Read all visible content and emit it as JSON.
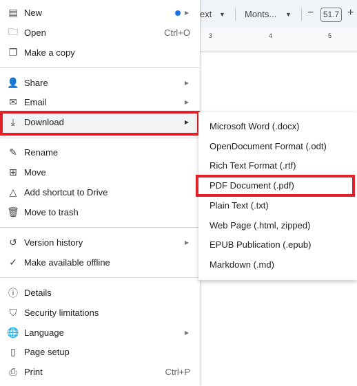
{
  "toolbar": {
    "style_partial": "ext",
    "font": "Monts...",
    "font_size": "51.7",
    "minus": "−",
    "plus": "+"
  },
  "ruler": {
    "marks": [
      "3",
      "4",
      "5"
    ]
  },
  "menu": {
    "items": [
      {
        "label": "New",
        "icon": "document-icon",
        "submenu": true,
        "badge": true
      },
      {
        "label": "Open",
        "icon": "folder-icon",
        "shortcut": "Ctrl+O"
      },
      {
        "label": "Make a copy",
        "icon": "copy-icon"
      },
      {
        "label": "Share",
        "icon": "person-add-icon",
        "submenu": true
      },
      {
        "label": "Email",
        "icon": "email-icon",
        "submenu": true
      },
      {
        "label": "Download",
        "icon": "download-icon",
        "submenu": true,
        "highlighted": true
      },
      {
        "label": "Rename",
        "icon": "rename-icon"
      },
      {
        "label": "Move",
        "icon": "move-folder-icon"
      },
      {
        "label": "Add shortcut to Drive",
        "icon": "drive-shortcut-icon"
      },
      {
        "label": "Move to trash",
        "icon": "trash-icon"
      },
      {
        "label": "Version history",
        "icon": "history-icon",
        "submenu": true
      },
      {
        "label": "Make available offline",
        "icon": "offline-icon"
      },
      {
        "label": "Details",
        "icon": "info-icon"
      },
      {
        "label": "Security limitations",
        "icon": "shield-icon"
      },
      {
        "label": "Language",
        "icon": "globe-icon",
        "submenu": true
      },
      {
        "label": "Page setup",
        "icon": "page-setup-icon"
      },
      {
        "label": "Print",
        "icon": "print-icon",
        "shortcut": "Ctrl+P"
      }
    ]
  },
  "download_submenu": {
    "items": [
      "Microsoft Word (.docx)",
      "OpenDocument Format (.odt)",
      "Rich Text Format (.rtf)",
      "PDF Document (.pdf)",
      "Plain Text (.txt)",
      "Web Page (.html, zipped)",
      "EPUB Publication (.epub)",
      "Markdown (.md)"
    ],
    "highlighted": "PDF Document (.pdf)"
  },
  "colors": {
    "highlight": "#e2202a",
    "badge": "#1a73e8"
  }
}
